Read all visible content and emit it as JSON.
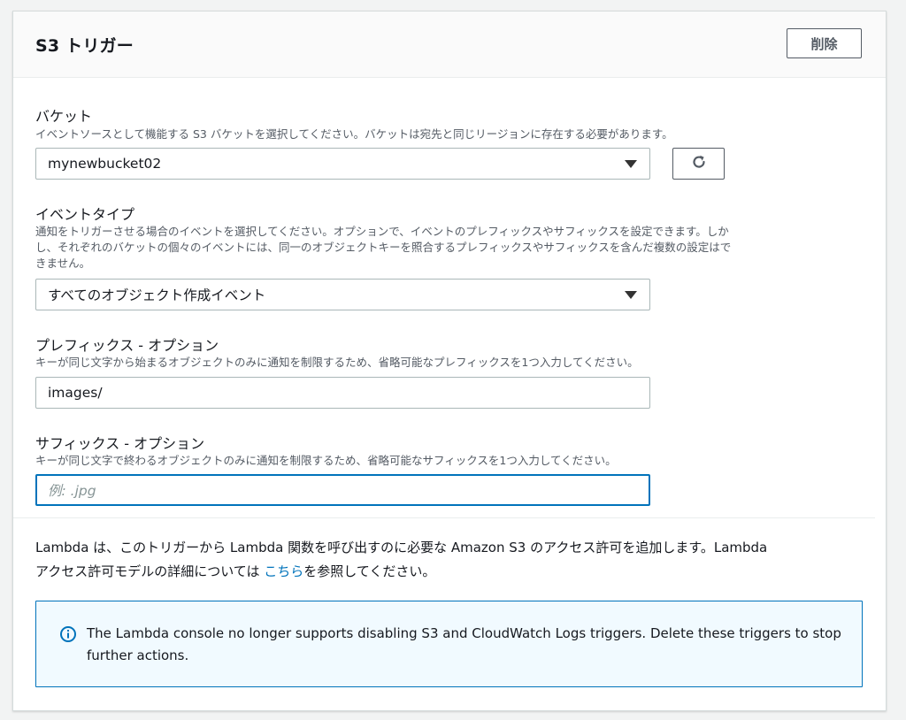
{
  "panel": {
    "title": "S3 トリガー",
    "delete_label": "削除"
  },
  "bucket": {
    "label": "バケット",
    "description": "イベントソースとして機能する S3 バケットを選択してください。バケットは宛先と同じリージョンに存在する必要があります。",
    "value": "mynewbucket02",
    "refresh_icon": "refresh-icon"
  },
  "event_type": {
    "label": "イベントタイプ",
    "description_lines": [
      "通知をトリガーさせる場合のイベントを選択してください。オプションで、イベントのプレフィックスやサフィックスを設定できます。しか",
      "し、それぞれのバケットの個々のイベントには、同一のオブジェクトキーを照合するプレフィックスやサフィックスを含んだ複数の設定はで",
      "きません。"
    ],
    "value": "すべてのオブジェクト作成イベント"
  },
  "prefix": {
    "label": "プレフィックス - オプション",
    "description": "キーが同じ文字から始まるオブジェクトのみに通知を制限するため、省略可能なプレフィックスを1つ入力してください。",
    "value": "images/"
  },
  "suffix": {
    "label": "サフィックス - オプション",
    "description": "キーが同じ文字で終わるオブジェクトのみに通知を制限するため、省略可能なサフィックスを1つ入力してください。",
    "placeholder": "例: .jpg",
    "value": ""
  },
  "permission": {
    "line1": "Lambda は、このトリガーから Lambda 関数を呼び出すのに必要な Amazon S3 のアクセス許可を追加します。Lambda",
    "line2_before": "アクセス許可モデルの詳細については ",
    "link_text": "こちら",
    "line2_after": "を参照してください。"
  },
  "info_alert": {
    "icon": "info-icon",
    "text": "The Lambda console no longer supports disabling S3 and CloudWatch Logs triggers. Delete these triggers to stop further actions."
  },
  "colors": {
    "accent": "#0073bb",
    "info_bg": "#f1faff"
  }
}
